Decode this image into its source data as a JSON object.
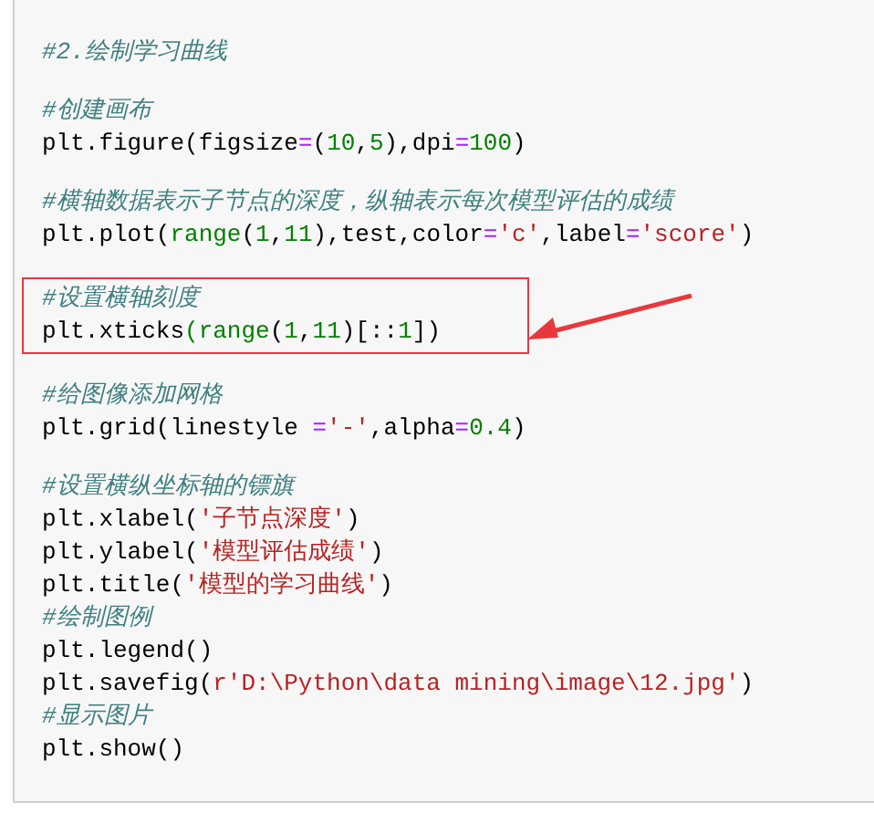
{
  "code_cell": {
    "blocks": [
      {
        "kind": "plain",
        "lines": [
          {
            "kind": "comment",
            "tokens": [
              {
                "kind": "comment",
                "text": "#2.绘制学习曲线"
              }
            ]
          },
          {
            "kind": "blank"
          },
          {
            "kind": "comment",
            "tokens": [
              {
                "kind": "comment",
                "text": "#创建画布"
              }
            ]
          },
          {
            "kind": "code",
            "tokens": [
              {
                "kind": "plain",
                "text": "plt.figure(figsize"
              },
              {
                "kind": "operator",
                "text": "="
              },
              {
                "kind": "plain",
                "text": "("
              },
              {
                "kind": "number",
                "text": "10"
              },
              {
                "kind": "plain",
                "text": ","
              },
              {
                "kind": "number",
                "text": "5"
              },
              {
                "kind": "plain",
                "text": "),dpi"
              },
              {
                "kind": "operator",
                "text": "="
              },
              {
                "kind": "number",
                "text": "100"
              },
              {
                "kind": "plain",
                "text": ")"
              }
            ]
          },
          {
            "kind": "blank"
          },
          {
            "kind": "comment",
            "tokens": [
              {
                "kind": "comment",
                "text": "#横轴数据表示子节点的深度，纵轴表示每次模型评估的成绩"
              }
            ]
          },
          {
            "kind": "code",
            "tokens": [
              {
                "kind": "plain",
                "text": "plt.plot("
              },
              {
                "kind": "builtin",
                "text": "range"
              },
              {
                "kind": "plain",
                "text": "("
              },
              {
                "kind": "number",
                "text": "1"
              },
              {
                "kind": "plain",
                "text": ","
              },
              {
                "kind": "number",
                "text": "11"
              },
              {
                "kind": "plain",
                "text": "),test,color"
              },
              {
                "kind": "operator",
                "text": "="
              },
              {
                "kind": "string",
                "text": "'c'"
              },
              {
                "kind": "plain",
                "text": ",label"
              },
              {
                "kind": "operator",
                "text": "="
              },
              {
                "kind": "string",
                "text": "'score'"
              },
              {
                "kind": "plain",
                "text": ")"
              }
            ]
          },
          {
            "kind": "blank"
          }
        ]
      },
      {
        "kind": "annotated",
        "lines": [
          {
            "kind": "comment",
            "tokens": [
              {
                "kind": "comment",
                "text": "#设置横轴刻度"
              }
            ]
          },
          {
            "kind": "code",
            "tokens": [
              {
                "kind": "plain",
                "text": "plt.xticks"
              },
              {
                "kind": "builtin",
                "text": "(range"
              },
              {
                "kind": "plain",
                "text": "("
              },
              {
                "kind": "number",
                "text": "1"
              },
              {
                "kind": "plain",
                "text": ","
              },
              {
                "kind": "number",
                "text": "11"
              },
              {
                "kind": "plain",
                "text": ")[::"
              },
              {
                "kind": "number",
                "text": "1"
              },
              {
                "kind": "plain",
                "text": "])"
              }
            ]
          }
        ]
      },
      {
        "kind": "plain",
        "lines": [
          {
            "kind": "blank"
          },
          {
            "kind": "comment",
            "tokens": [
              {
                "kind": "comment",
                "text": "#给图像添加网格"
              }
            ]
          },
          {
            "kind": "code",
            "tokens": [
              {
                "kind": "plain",
                "text": "plt.grid(linestyle "
              },
              {
                "kind": "operator",
                "text": "="
              },
              {
                "kind": "string",
                "text": "'-'"
              },
              {
                "kind": "plain",
                "text": ",alpha"
              },
              {
                "kind": "operator",
                "text": "="
              },
              {
                "kind": "number",
                "text": "0.4"
              },
              {
                "kind": "plain",
                "text": ")"
              }
            ]
          },
          {
            "kind": "blank"
          },
          {
            "kind": "comment",
            "tokens": [
              {
                "kind": "comment",
                "text": "#设置横纵坐标轴的镖旗"
              }
            ]
          },
          {
            "kind": "code",
            "tokens": [
              {
                "kind": "plain",
                "text": "plt.xlabel("
              },
              {
                "kind": "string",
                "text": "'子节点深度'"
              },
              {
                "kind": "plain",
                "text": ")"
              }
            ]
          },
          {
            "kind": "code",
            "tokens": [
              {
                "kind": "plain",
                "text": "plt.ylabel("
              },
              {
                "kind": "string",
                "text": "'模型评估成绩'"
              },
              {
                "kind": "plain",
                "text": ")"
              }
            ]
          },
          {
            "kind": "code",
            "tokens": [
              {
                "kind": "plain",
                "text": "plt.title("
              },
              {
                "kind": "string",
                "text": "'模型的学习曲线'"
              },
              {
                "kind": "plain",
                "text": ")"
              }
            ]
          },
          {
            "kind": "comment",
            "tokens": [
              {
                "kind": "comment",
                "text": "#绘制图例"
              }
            ]
          },
          {
            "kind": "code",
            "tokens": [
              {
                "kind": "plain",
                "text": "plt.legend()"
              }
            ]
          },
          {
            "kind": "code",
            "tokens": [
              {
                "kind": "plain",
                "text": "plt.savefig("
              },
              {
                "kind": "string",
                "text": "r'D:\\Python\\data mining\\image\\12.jpg'"
              },
              {
                "kind": "plain",
                "text": ")"
              }
            ]
          },
          {
            "kind": "comment",
            "tokens": [
              {
                "kind": "comment",
                "text": "#显示图片"
              }
            ]
          },
          {
            "kind": "code",
            "tokens": [
              {
                "kind": "plain",
                "text": "plt.show()"
              }
            ]
          }
        ]
      }
    ]
  }
}
